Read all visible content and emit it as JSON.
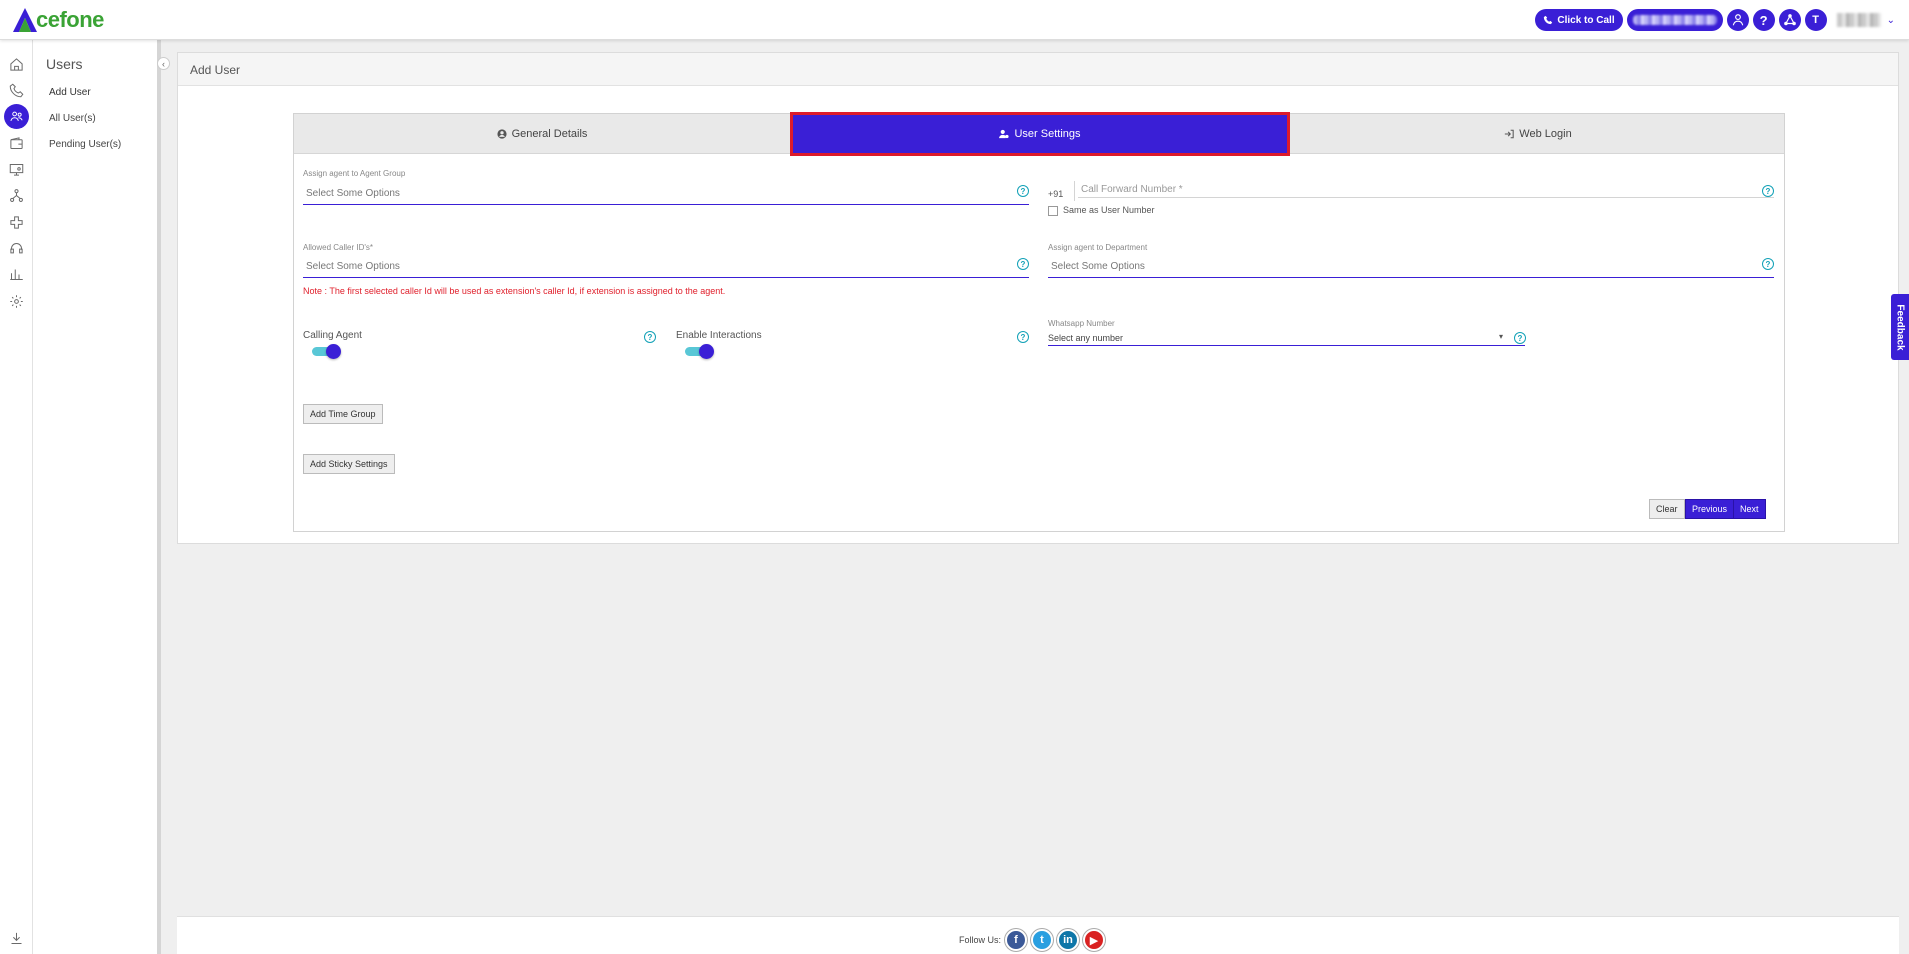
{
  "header": {
    "brand": "cefone",
    "click_to_call": "Click to Call",
    "avatar_initial": "T"
  },
  "submenu": {
    "title": "Users",
    "items": [
      {
        "label": "Add User"
      },
      {
        "label": "All User(s)"
      },
      {
        "label": "Pending User(s)"
      }
    ]
  },
  "panel": {
    "title": "Add User"
  },
  "tabs": [
    {
      "label": "General Details",
      "icon": "user-circle-icon"
    },
    {
      "label": "User Settings",
      "icon": "user-settings-icon"
    },
    {
      "label": "Web Login",
      "icon": "login-icon"
    }
  ],
  "form": {
    "agent_group": {
      "label": "Assign agent to Agent Group",
      "placeholder": "Select Some Options"
    },
    "country_code": "+91",
    "call_forward": {
      "placeholder": "Call Forward Number *"
    },
    "same_as_user": "Same as User Number",
    "caller_ids": {
      "label": "Allowed Caller ID's*",
      "placeholder": "Select Some Options"
    },
    "caller_note": "Note : The first selected caller Id will be used as extension's caller Id, if extension is assigned to the agent.",
    "department": {
      "label": "Assign agent to Department",
      "placeholder": "Select Some Options"
    },
    "calling_agent": "Calling Agent",
    "enable_interactions": "Enable Interactions",
    "whatsapp": {
      "label": "Whatsapp Number",
      "value": "Select any number"
    },
    "add_time_group": "Add Time Group",
    "add_sticky": "Add Sticky Settings",
    "clear": "Clear",
    "previous": "Previous",
    "next": "Next"
  },
  "feedback": "Feedback",
  "footer": {
    "follow_us": "Follow Us:",
    "social": [
      "f",
      "t",
      "in",
      "▶"
    ]
  },
  "colors": {
    "primary": "#3a1fd6",
    "brand_green": "#3aa335",
    "help_teal": "#12a1b7",
    "error_red": "#e0202c",
    "highlight_border": "#dd1b2b"
  }
}
